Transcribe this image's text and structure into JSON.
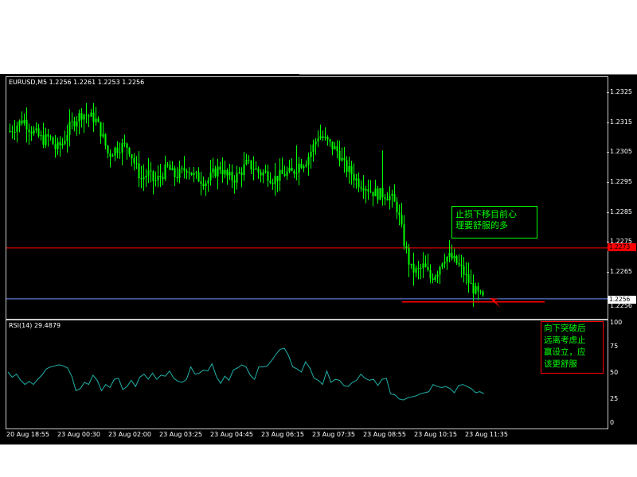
{
  "symbol_label": "EURUSD,M5  1.2256 1.2261 1.2253 1.2256",
  "rsi_label": "RSI(14)  29.4879",
  "price_axis": [
    "1.2325",
    "1.2315",
    "1.2305",
    "1.2295",
    "1.2285",
    "1.2275",
    "1.2265",
    "1.2256"
  ],
  "current_price_tag": "1.2256",
  "red_line_tag": "1.2273",
  "rsi_axis": [
    "100",
    "75",
    "50",
    "25",
    "0"
  ],
  "time_axis": [
    "20 Aug 18:55",
    "23 Aug 00:30",
    "23 Aug 02:00",
    "23 Aug 03:25",
    "23 Aug 04:45",
    "23 Aug 06:15",
    "23 Aug 07:35",
    "23 Aug 08:55",
    "23 Aug 10:15",
    "23 Aug 11:35"
  ],
  "note_upper": [
    "止损下移目前心",
    "理要舒服的多"
  ],
  "note_lower": [
    "向下突破后",
    "远离考虑止",
    "赢设立，应",
    "该更舒服"
  ],
  "colors": {
    "background": "#000000",
    "candle": "#00ff00",
    "rsi": "#20b2aa",
    "red_line": "#ff0000",
    "blue_line": "#6f8fff",
    "note_green": "#00ff00",
    "note_red_border": "#ff0000",
    "price_tag_bg": "#ff0000"
  },
  "chart_data": {
    "type": "candlestick",
    "symbol": "EURUSD",
    "timeframe": "M5",
    "ylim": [
      1.2253,
      1.233
    ],
    "close_path": [
      1.2312,
      1.2314,
      1.2316,
      1.2313,
      1.2311,
      1.2309,
      1.231,
      1.2306,
      1.2308,
      1.2313,
      1.2316,
      1.2318,
      1.2317,
      1.2316,
      1.2311,
      1.2304,
      1.2306,
      1.2307,
      1.2307,
      1.2301,
      1.2296,
      1.2298,
      1.2295,
      1.2297,
      1.23,
      1.2297,
      1.2298,
      1.23,
      1.2297,
      1.2296,
      1.2295,
      1.2298,
      1.23,
      1.2297,
      1.2296,
      1.2298,
      1.2301,
      1.23,
      1.2298,
      1.2298,
      1.2296,
      1.2297,
      1.2298,
      1.2298,
      1.2301,
      1.2302,
      1.2306,
      1.2311,
      1.2309,
      1.2307,
      1.2305,
      1.23,
      1.2298,
      1.2295,
      1.2294,
      1.2292,
      1.2291,
      1.2291,
      1.229,
      1.2286,
      1.2275,
      1.2266,
      1.2265,
      1.2267,
      1.2263,
      1.2265,
      1.227,
      1.227,
      1.2268,
      1.2265,
      1.2261,
      1.2258,
      1.2256
    ],
    "rsi": {
      "name": "RSI(14)",
      "current": 29.4879,
      "ylim": [
        0,
        100
      ],
      "levels": [
        100,
        75,
        50,
        25,
        0
      ],
      "values": [
        50,
        45,
        48,
        42,
        38,
        41,
        38,
        43,
        47,
        53,
        55,
        56,
        57,
        56,
        54,
        46,
        32,
        34,
        40,
        38,
        47,
        42,
        32,
        38,
        35,
        43,
        44,
        33,
        36,
        42,
        36,
        45,
        48,
        43,
        49,
        43,
        47,
        46,
        51,
        44,
        41,
        40,
        43,
        55,
        48,
        49,
        52,
        51,
        58,
        46,
        39,
        46,
        42,
        52,
        54,
        57,
        55,
        47,
        43,
        55,
        55,
        56,
        61,
        67,
        72,
        73,
        66,
        55,
        53,
        50,
        60,
        54,
        44,
        42,
        38,
        51,
        40,
        43,
        42,
        37,
        36,
        40,
        42,
        48,
        44,
        42,
        43,
        37,
        43,
        44,
        29,
        28,
        24,
        23,
        25,
        26,
        27,
        29,
        30,
        31,
        38,
        36,
        35,
        36,
        34,
        30,
        37,
        38,
        36,
        34,
        30,
        31,
        29
      ]
    },
    "horizontal_lines": [
      {
        "price": 1.2273,
        "color": "#ff0000"
      },
      {
        "price": 1.2256,
        "color": "#6f8fff"
      }
    ],
    "hand_drawn": {
      "trendline_price": 1.2255,
      "color": "#ff0000",
      "arrow": true
    }
  }
}
